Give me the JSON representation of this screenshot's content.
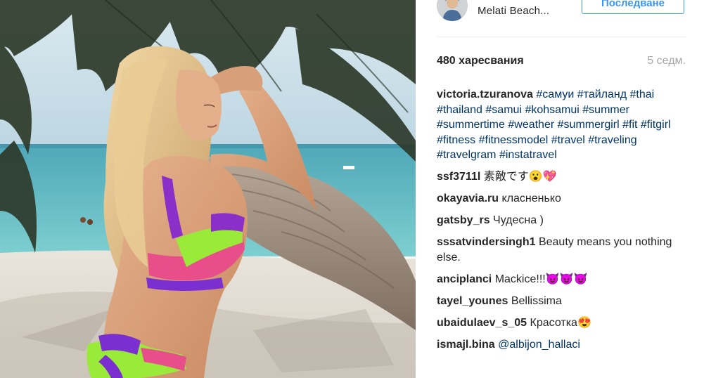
{
  "header": {
    "username": "Melati Beach...",
    "follow_label": "Последване"
  },
  "stats": {
    "likes": "480 харесвания",
    "time_ago": "5 седм."
  },
  "caption": {
    "author": "victoria.tzuranova",
    "tags": [
      "#самуи",
      "#тайланд",
      "#thai",
      "#thailand",
      "#samui",
      "#kohsamui",
      "#summer",
      "#summertime",
      "#weather",
      "#summergirl",
      "#fit",
      "#fitgirl",
      "#fitness",
      "#fitnessmodel",
      "#travel",
      "#traveling",
      "#travelgram",
      "#instatravel"
    ]
  },
  "comments": [
    {
      "author": "ssf3711l",
      "text": "素敵です😮💖"
    },
    {
      "author": "okayavia.ru",
      "text": "класненько"
    },
    {
      "author": "gatsby_rs",
      "text": "Чудесна )"
    },
    {
      "author": "sssatvindersingh1",
      "text": "Beauty means you nothing else."
    },
    {
      "author": "anciplanci",
      "text": "Mackice!!!😈😈😈"
    },
    {
      "author": "tayel_younes",
      "text": "Bellissima"
    },
    {
      "author": "ubaidulaev_s_05",
      "text": "Красотка😍"
    },
    {
      "author": "ismajl.bina",
      "mention": "@albijon_hallaci"
    }
  ],
  "colors": {
    "accent": "#3897f0",
    "hashtag": "#003569",
    "muted": "#a5a7aa",
    "text": "#262626"
  }
}
